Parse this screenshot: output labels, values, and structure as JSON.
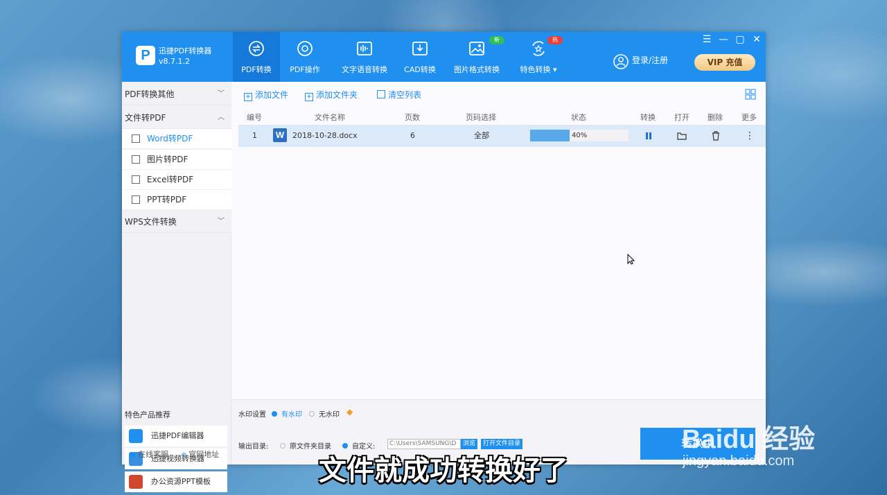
{
  "app": {
    "name": "迅捷PDF转换器",
    "version": "v8.7.1.2",
    "logo_letter": "P"
  },
  "nav": {
    "tabs": [
      {
        "label": "PDF转换",
        "icon": "pdf-convert-icon",
        "active": true
      },
      {
        "label": "PDF操作",
        "icon": "pdf-operate-icon"
      },
      {
        "label": "文字语音转换",
        "icon": "audio-wave-icon"
      },
      {
        "label": "CAD转换",
        "icon": "cad-icon"
      },
      {
        "label": "图片格式转换",
        "icon": "image-icon",
        "badge": "新"
      },
      {
        "label": "特色转换 ▾",
        "icon": "feature-icon",
        "badge": "热"
      }
    ],
    "login_label": "登录/注册",
    "vip_label": "VIP 充值",
    "badge_new_color": "#2fbf5a",
    "badge_hot_color": "#e8403a"
  },
  "window_controls": {
    "menu": "☰",
    "minimize": "—",
    "maximize": "▢",
    "close": "✕"
  },
  "sidebar": {
    "groups": [
      {
        "label": "PDF转换其他",
        "chevron": "﹀"
      },
      {
        "label": "文件转PDF",
        "chevron": "︿"
      },
      {
        "label": "WPS文件转换",
        "chevron": "﹀"
      }
    ],
    "items": [
      {
        "label": "Word转PDF",
        "active": true
      },
      {
        "label": "图片转PDF"
      },
      {
        "label": "Excel转PDF"
      },
      {
        "label": "PPT转PDF"
      }
    ],
    "recommend_title": "特色产品推荐",
    "recommend": [
      {
        "label": "迅捷PDF编辑器"
      },
      {
        "label": "迅捷视频转换器"
      },
      {
        "label": "办公资源PPT模板"
      }
    ],
    "footer": {
      "support": "在线客服",
      "website": "官网地址"
    }
  },
  "toolbar": {
    "add_file": "添加文件",
    "add_folder": "添加文件夹",
    "clear_list": "清空列表"
  },
  "table": {
    "headers": [
      "编号",
      "文件名称",
      "页数",
      "页码选择",
      "状态",
      "转换",
      "打开",
      "删除",
      "更多"
    ],
    "rows": [
      {
        "index": "1",
        "filename": "2018-10-28.docx",
        "pages": "6",
        "page_select": "全部",
        "progress": 0.4,
        "progress_label": "40%"
      }
    ]
  },
  "bottom": {
    "watermark_label": "水印设置",
    "watermark_on": "有水印",
    "watermark_off": "无水印",
    "output_label": "输出目录:",
    "output_original": "原文件夹目录",
    "output_custom": "自定义:",
    "output_path": "C:\\Users\\SAMSUNG\\D",
    "browse": "浏览",
    "open_folder": "打开文件目录",
    "convert_button": "转换中"
  },
  "overlay": {
    "subtitle": "文件就成功转换好了",
    "watermark_logo": "Baidu 经验",
    "watermark_url": "jingyan.baidu.com"
  }
}
